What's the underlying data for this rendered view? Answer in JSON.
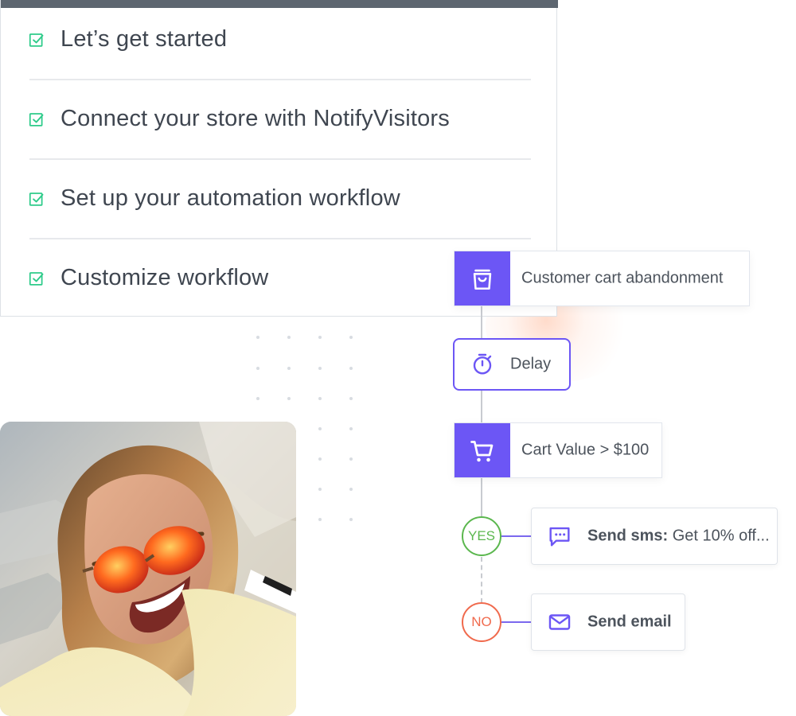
{
  "checklist": {
    "items": [
      {
        "label": "Let’s get started",
        "checked": true
      },
      {
        "label": "Connect your store with NotifyVisitors",
        "checked": true
      },
      {
        "label": "Set up your automation workflow",
        "checked": true
      },
      {
        "label": "Customize workflow",
        "checked": true
      }
    ]
  },
  "workflow": {
    "trigger": {
      "label": "Customer cart abandonment",
      "icon": "shopping-bag-icon"
    },
    "delay": {
      "label": "Delay",
      "icon": "stopwatch-icon"
    },
    "condition": {
      "label": "Cart Value > $100",
      "icon": "shopping-cart-icon"
    },
    "yes_branch": {
      "label": "YES",
      "action_label": "Send sms:",
      "action_text": " Get 10% off...",
      "icon": "chat-bubble-icon"
    },
    "no_branch": {
      "label": "NO",
      "action_label": "Send email",
      "icon": "mail-icon"
    }
  },
  "colors": {
    "accent": "#6c56f5",
    "check": "#2ecb8a",
    "yes": "#5bb74e",
    "no": "#f06a4d",
    "text": "#3f4650"
  }
}
